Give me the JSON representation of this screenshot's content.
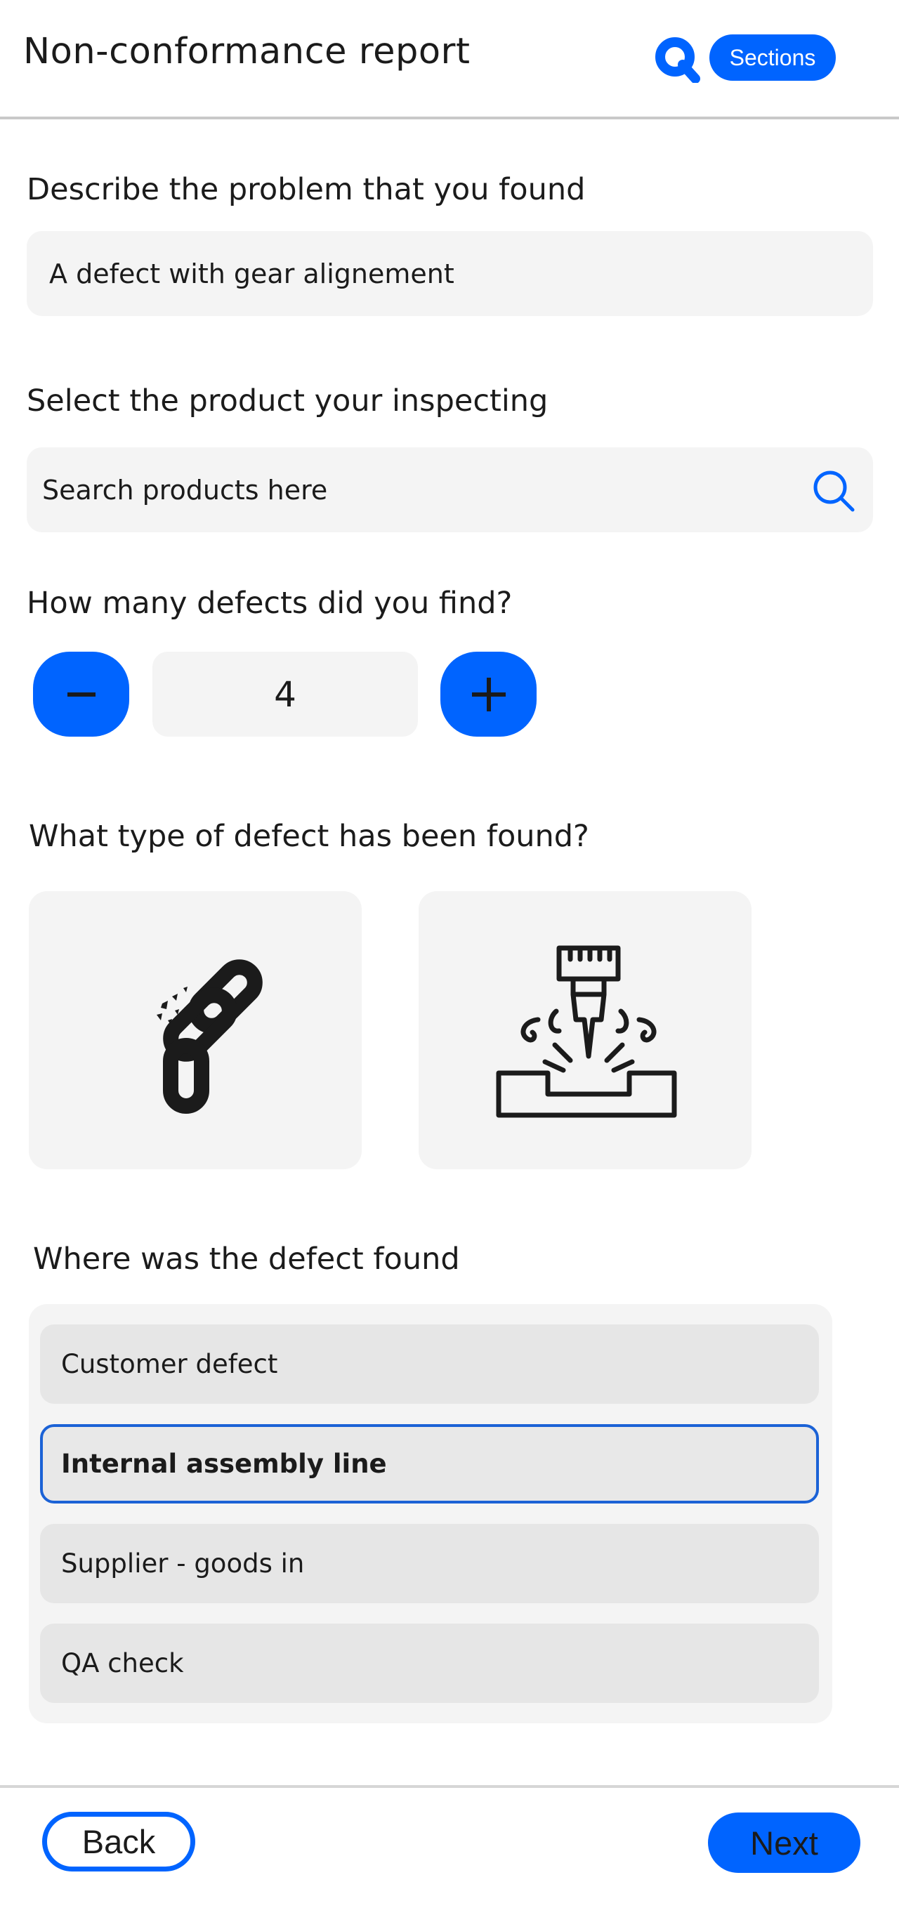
{
  "header": {
    "title": "Non-conformance report",
    "logo_icon": "q-logo-icon",
    "sections_label": "Sections",
    "accent_color": "#0064ff"
  },
  "form": {
    "problem": {
      "label": "Describe the problem that you found",
      "value": "A defect with gear alignement"
    },
    "product": {
      "label": "Select the product your inspecting",
      "placeholder": "Search products here",
      "icon": "search-icon"
    },
    "defect_count": {
      "label": "How many defects did you find?",
      "value": "4",
      "decrement_icon": "minus-icon",
      "increment_icon": "plus-icon"
    },
    "defect_type": {
      "label": "What type of defect has been found?",
      "options": [
        {
          "icon": "broken-chain-icon"
        },
        {
          "icon": "machining-drill-icon"
        }
      ]
    },
    "location": {
      "label": "Where was the defect found",
      "options": [
        {
          "label": "Customer defect",
          "selected": false
        },
        {
          "label": "Internal assembly line",
          "selected": true
        },
        {
          "label": "Supplier - goods in",
          "selected": false
        },
        {
          "label": "QA check",
          "selected": false
        }
      ],
      "selected_border_color": "#1b62d6"
    }
  },
  "footer": {
    "back_label": "Back",
    "next_label": "Next"
  }
}
